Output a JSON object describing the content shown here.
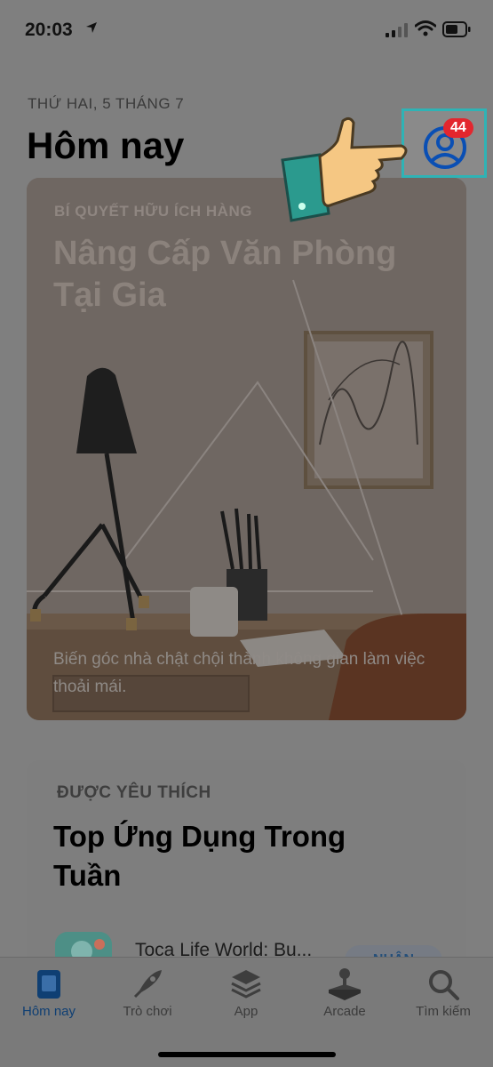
{
  "status": {
    "time": "20:03"
  },
  "header": {
    "date": "THỨ HAI, 5 THÁNG 7",
    "title": "Hôm nay",
    "badge_count": "44"
  },
  "feature_card": {
    "eyebrow": "BÍ QUYẾT HỮU ÍCH HÀNG",
    "title": "Nâng Cấp Văn Phòng Tại Gia",
    "description": "Biến góc nhà chật chội thành không gian làm việc thoải mái."
  },
  "list_card": {
    "eyebrow": "ĐƯỢC YÊU THÍCH",
    "title": "Top Ứng Dụng Trong Tuần",
    "app_name": "Toca Life World: Bu...",
    "get_label": "NHẬN"
  },
  "tabs": [
    {
      "label": "Hôm nay",
      "icon": "today-icon",
      "active": true
    },
    {
      "label": "Trò chơi",
      "icon": "rocket-icon",
      "active": false
    },
    {
      "label": "App",
      "icon": "layers-icon",
      "active": false
    },
    {
      "label": "Arcade",
      "icon": "joystick-icon",
      "active": false
    },
    {
      "label": "Tìm kiếm",
      "icon": "search-icon",
      "active": false
    }
  ],
  "colors": {
    "accent": "#0f3f73",
    "badge": "#e3262e",
    "highlight_border": "#2fb3b5"
  }
}
